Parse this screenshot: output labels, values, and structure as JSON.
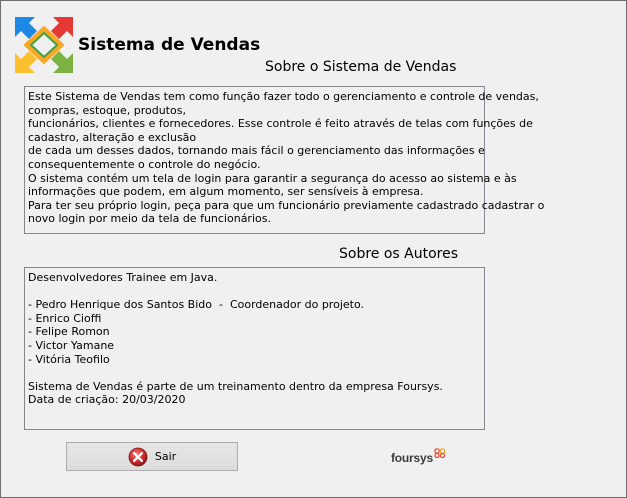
{
  "app": {
    "title": "Sistema de Vendas",
    "logo_icon": "colorful-arrows-logo-icon"
  },
  "about": {
    "title": "Sobre o Sistema de Vendas",
    "lines": [
      "Este Sistema de Vendas tem como função fazer todo o gerenciamento e controle de vendas,",
      "compras, estoque, produtos,",
      "funcionários, clientes e fornecedores. Esse controle é feito através de telas com funções de",
      "cadastro, alteração e exclusão",
      "de cada um desses dados, tornando mais fácil o gerenciamento das informações e",
      "consequentemente o controle do negócio.",
      "O sistema contém um tela de login para garantir a segurança do acesso ao sistema e às",
      "informações que podem, em algum momento, ser sensíveis à empresa.",
      "Para ter seu próprio login, peça para que um funcionário previamente cadastrado cadastrar o",
      "novo login por meio da tela de funcionários."
    ]
  },
  "authors": {
    "title": "Sobre os Autores",
    "lines": [
      "Desenvolvedores Trainee em Java.",
      "",
      "- Pedro Henrique dos Santos Bido  -  Coordenador do projeto.",
      "- Enrico Cioffi",
      "- Felipe Romon",
      "- Victor Yamane",
      "- Vitória Teofilo",
      "",
      "Sistema de Vendas é parte de um treinamento dentro da empresa Foursys.",
      "Data de criação: 20/03/2020"
    ]
  },
  "footer": {
    "exit_label": "Sair",
    "exit_icon": "red-x-circle-icon",
    "brand_name": "foursys",
    "brand_icon": "foursys-logo-icon"
  },
  "colors": {
    "window_bg": "#f0f0f0",
    "exit_icon_red": "#c62828",
    "brand_accent": "#e8442e"
  }
}
